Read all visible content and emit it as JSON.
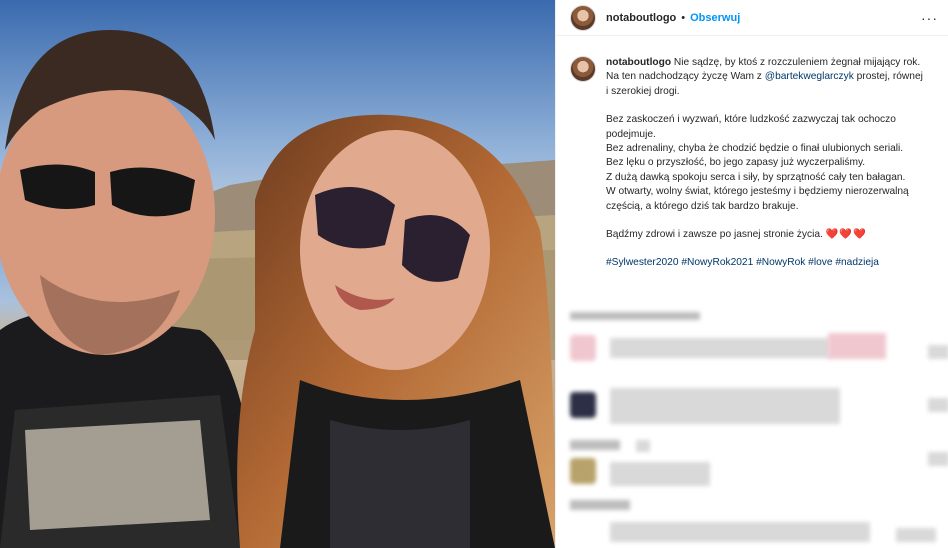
{
  "post": {
    "username": "notaboutlogo",
    "separator": "•",
    "follow_label": "Obserwuj",
    "more_label": "···"
  },
  "caption": {
    "author": "notaboutlogo",
    "intro_before_mention": "Nie sądzę, by ktoś z rozczuleniem żegnał mijający rok. Na ten nadchodzący życzę Wam z",
    "mention": "@bartekweglarczyk",
    "intro_after_mention": "prostej, równej i szerokiej drogi.",
    "lines": [
      "Bez zaskoczeń i wyzwań, które ludzkość zazwyczaj tak ochoczo podejmuje.",
      "Bez adrenaliny, chyba że chodzić będzie o finał ulubionych seriali.",
      "Bez lęku o przyszłość, bo jego zapasy już wyczerpaliśmy.",
      "Z dużą dawką spokoju serca i siły, by sprzątność cały ten bałagan.",
      "W otwarty, wolny świat, którego jesteśmy i będziemy nierozerwalną częścią, a którego dziś tak bardzo brakuje."
    ],
    "closing": "Bądźmy zdrowi i zawsze po jasnej stronie życia.",
    "hearts": "❤️❤️❤️",
    "hashtags": "#Sylwester2020 #NowyRok2021 #NowyRok #love #nadzieja"
  },
  "colors": {
    "link": "#00376b",
    "follow": "#0095f6",
    "text": "#262626"
  },
  "icons": {
    "avatar": "profile-avatar",
    "more": "more-options-icon"
  }
}
